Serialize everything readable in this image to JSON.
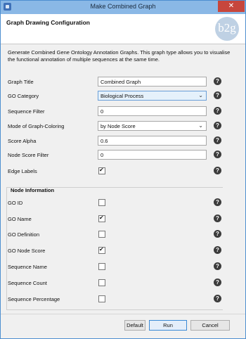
{
  "window": {
    "title": "Make Combined Graph",
    "close_glyph": "✕"
  },
  "header": {
    "title": "Graph Drawing Configuration",
    "logo_text": "b2g"
  },
  "description": "Generate Combined Gene Ontology Annotation Graphs. This graph type allows you to visualise the functional annotation of multiple sequences at the same time.",
  "fields": {
    "graph_title": {
      "label": "Graph Title",
      "value": "Combined Graph"
    },
    "go_category": {
      "label": "GO Category",
      "value": "Biological Process"
    },
    "sequence_filter": {
      "label": "Sequence Filter",
      "value": "0"
    },
    "mode_graph_coloring": {
      "label": "Mode of Graph-Coloring",
      "value": "by Node Score"
    },
    "score_alpha": {
      "label": "Score Alpha",
      "value": "0.6"
    },
    "node_score_filter": {
      "label": "Node Score Filter",
      "value": "0"
    },
    "edge_labels": {
      "label": "Edge Labels",
      "checked": true
    }
  },
  "node_information": {
    "title": "Node Information",
    "items": [
      {
        "label": "GO ID",
        "checked": false
      },
      {
        "label": "GO Name",
        "checked": true
      },
      {
        "label": "GO Definition",
        "checked": false
      },
      {
        "label": "GO Node Score",
        "checked": true
      },
      {
        "label": "Sequence Name",
        "checked": false
      },
      {
        "label": "Sequence Count",
        "checked": false
      },
      {
        "label": "Sequence Percentage",
        "checked": false
      }
    ]
  },
  "help_glyph": "?",
  "dropdown_caret": "⌄",
  "buttons": {
    "default": "Default",
    "run": "Run",
    "cancel": "Cancel"
  }
}
